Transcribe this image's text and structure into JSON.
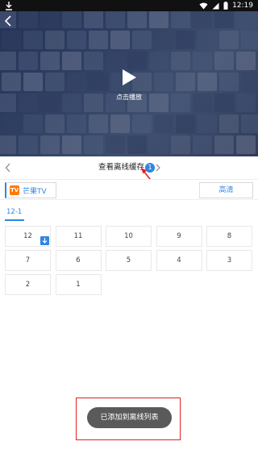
{
  "status_bar": {
    "time": "12:19",
    "icons": [
      "download-icon",
      "wifi-icon",
      "signal-icon",
      "battery-icon"
    ]
  },
  "video": {
    "play_label": "点击播放",
    "icons": [
      "back-arrow-icon",
      "play-icon"
    ]
  },
  "offline_cache": {
    "title": "查看离线缓存",
    "count": "1"
  },
  "source": {
    "logo_text": "TV",
    "name": "芒果TV",
    "quality": "高清"
  },
  "season_tab": "12-1",
  "episodes": [
    {
      "label": "12",
      "downloaded": true
    },
    {
      "label": "11",
      "downloaded": false
    },
    {
      "label": "10",
      "downloaded": false
    },
    {
      "label": "9",
      "downloaded": false
    },
    {
      "label": "8",
      "downloaded": false
    },
    {
      "label": "7",
      "downloaded": false
    },
    {
      "label": "6",
      "downloaded": false
    },
    {
      "label": "5",
      "downloaded": false
    },
    {
      "label": "4",
      "downloaded": false
    },
    {
      "label": "3",
      "downloaded": false
    },
    {
      "label": "2",
      "downloaded": false
    },
    {
      "label": "1",
      "downloaded": false
    }
  ],
  "toast": {
    "message": "已添加到离线列表"
  },
  "colors": {
    "accent": "#2f86e3",
    "annotation_red": "#e02020",
    "toast_bg": "#5a5a5a",
    "brand_orange": "#ff7a00"
  }
}
